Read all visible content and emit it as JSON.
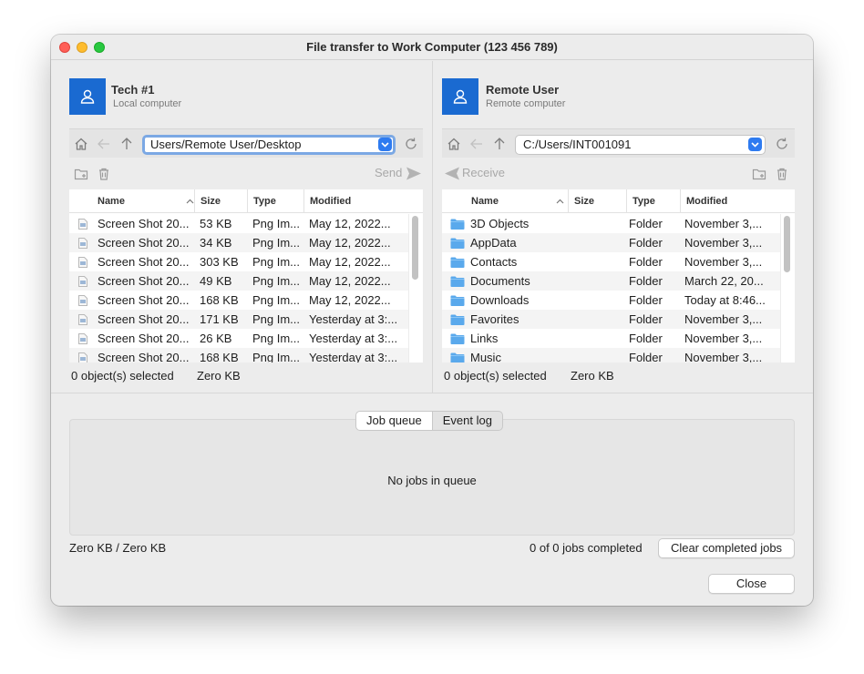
{
  "window": {
    "title": "File transfer to Work Computer (123 456 789)"
  },
  "local": {
    "name": "Tech #1",
    "subtitle": "Local computer",
    "path": "Users/Remote User/Desktop",
    "action_label": "Send",
    "columns": [
      "Name",
      "Size",
      "Type",
      "Modified"
    ],
    "rows": [
      {
        "name": "Screen Shot 20...",
        "size": "53 KB",
        "type": "Png Im...",
        "modified": "May 12, 2022..."
      },
      {
        "name": "Screen Shot 20...",
        "size": "34 KB",
        "type": "Png Im...",
        "modified": "May 12, 2022..."
      },
      {
        "name": "Screen Shot 20...",
        "size": "303 KB",
        "type": "Png Im...",
        "modified": "May 12, 2022..."
      },
      {
        "name": "Screen Shot 20...",
        "size": "49 KB",
        "type": "Png Im...",
        "modified": "May 12, 2022..."
      },
      {
        "name": "Screen Shot 20...",
        "size": "168 KB",
        "type": "Png Im...",
        "modified": "May 12, 2022..."
      },
      {
        "name": "Screen Shot 20...",
        "size": "171 KB",
        "type": "Png Im...",
        "modified": "Yesterday at 3:..."
      },
      {
        "name": "Screen Shot 20...",
        "size": "26 KB",
        "type": "Png Im...",
        "modified": "Yesterday at 3:..."
      },
      {
        "name": "Screen Shot 20...",
        "size": "168 KB",
        "type": "Png Im...",
        "modified": "Yesterday at 3:..."
      }
    ],
    "selected": "0 object(s) selected",
    "selected_size": "Zero KB"
  },
  "remote": {
    "name": "Remote User",
    "subtitle": "Remote computer",
    "path": "C:/Users/INT001091",
    "action_label": "Receive",
    "columns": [
      "Name",
      "Size",
      "Type",
      "Modified"
    ],
    "rows": [
      {
        "name": "3D Objects",
        "size": "",
        "type": "Folder",
        "modified": "November 3,..."
      },
      {
        "name": "AppData",
        "size": "",
        "type": "Folder",
        "modified": "November 3,..."
      },
      {
        "name": "Contacts",
        "size": "",
        "type": "Folder",
        "modified": "November 3,..."
      },
      {
        "name": "Documents",
        "size": "",
        "type": "Folder",
        "modified": "March 22, 20..."
      },
      {
        "name": "Downloads",
        "size": "",
        "type": "Folder",
        "modified": "Today at 8:46..."
      },
      {
        "name": "Favorites",
        "size": "",
        "type": "Folder",
        "modified": "November 3,..."
      },
      {
        "name": "Links",
        "size": "",
        "type": "Folder",
        "modified": "November 3,..."
      },
      {
        "name": "Music",
        "size": "",
        "type": "Folder",
        "modified": "November 3,..."
      }
    ],
    "selected": "0 object(s) selected",
    "selected_size": "Zero KB"
  },
  "queue": {
    "tabs": [
      "Job queue",
      "Event log"
    ],
    "empty_text": "No jobs in queue",
    "transfer_total": "Zero KB / Zero KB",
    "jobs_completed": "0 of 0 jobs completed",
    "clear_label": "Clear completed jobs"
  },
  "footer": {
    "close_label": "Close"
  },
  "colors": {
    "accent": "#1a6ad1",
    "folder": "#5aa9ec"
  }
}
